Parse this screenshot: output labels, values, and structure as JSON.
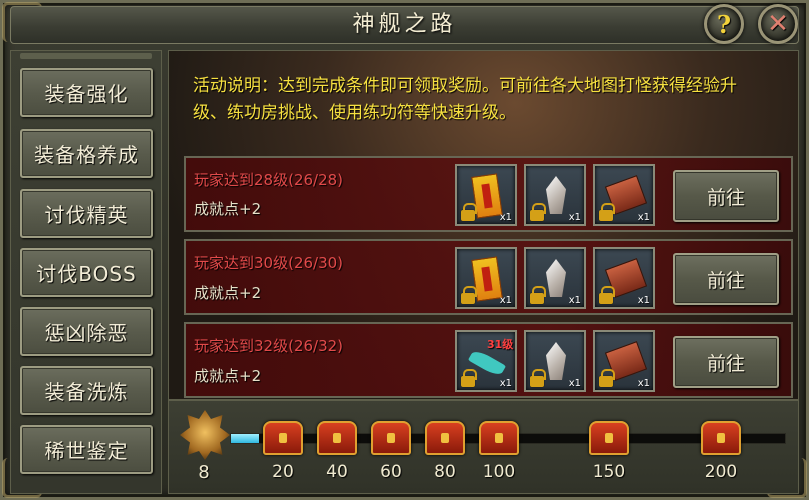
{
  "window": {
    "title": "神舰之路"
  },
  "sidebar": {
    "items": [
      {
        "label": "装备强化"
      },
      {
        "label": "装备格养成"
      },
      {
        "label": "讨伐精英"
      },
      {
        "label": "讨伐BOSS"
      },
      {
        "label": "惩凶除恶"
      },
      {
        "label": "装备洗炼"
      },
      {
        "label": "稀世鉴定"
      }
    ]
  },
  "description": "活动说明：达到完成条件即可领取奖励。可前往各大地图打怪获得经验升级、练功房挑战、使用练功符等快速升级。",
  "tasks": [
    {
      "title": "玩家达到28级(26/28)",
      "reward_points": "成就点+2",
      "button": "前往",
      "items": [
        {
          "icon": "scroll-icon",
          "qty": "x1"
        },
        {
          "icon": "crystal-icon",
          "qty": "x1"
        },
        {
          "icon": "book-icon",
          "qty": "x1"
        }
      ]
    },
    {
      "title": "玩家达到30级(26/30)",
      "reward_points": "成就点+2",
      "button": "前往",
      "items": [
        {
          "icon": "scroll-icon",
          "qty": "x1"
        },
        {
          "icon": "crystal-icon",
          "qty": "x1"
        },
        {
          "icon": "book-icon",
          "qty": "x1"
        }
      ]
    },
    {
      "title": "玩家达到32级(26/32)",
      "reward_points": "成就点+2",
      "button": "前往",
      "items": [
        {
          "icon": "feather-icon",
          "qty": "x1",
          "level": "31级"
        },
        {
          "icon": "crystal-icon",
          "qty": "x1"
        },
        {
          "icon": "book-icon",
          "qty": "x1"
        }
      ]
    }
  ],
  "progress": {
    "current": "8",
    "fill_fraction": 0.05,
    "milestones": [
      "20",
      "40",
      "60",
      "80",
      "100",
      "150",
      "200"
    ]
  },
  "colors": {
    "task_title": "#e04a4a",
    "description": "#f6e040",
    "progress_fill": "#30b8e0"
  }
}
